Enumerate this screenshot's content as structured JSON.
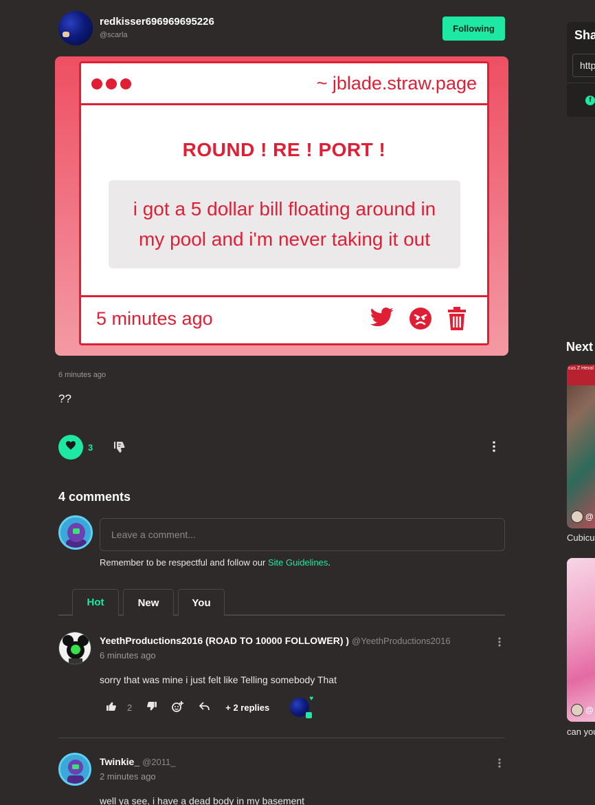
{
  "header": {
    "username": "redkisser696969695226",
    "handle": "@scarla",
    "follow_label": "Following"
  },
  "card": {
    "site": "~ jblade.straw.page",
    "title": "ROUND ! RE ! PORT !",
    "message": "i got a 5 dollar bill floating around in my pool and i'm never taking it out",
    "time": "5 minutes ago",
    "icons": [
      "twitter-icon",
      "angry-face-icon",
      "trash-icon"
    ],
    "accent_color": "#e01f35"
  },
  "post": {
    "time": "6 minutes ago",
    "body": "??",
    "like_count": "3"
  },
  "comments": {
    "title": "4 comments",
    "input_placeholder": "Leave a comment...",
    "guidelines_prefix": "Remember to be respectful and follow our ",
    "guidelines_link": "Site Guidelines",
    "guidelines_suffix": ".",
    "tabs": [
      {
        "label": "Hot",
        "active": true
      },
      {
        "label": "New",
        "active": false
      },
      {
        "label": "You",
        "active": false
      }
    ],
    "items": [
      {
        "name": "YeethProductions2016 (ROAD TO 10000 FOLLOWER) )",
        "handle": "@YeethProductions2016",
        "time": "6 minutes ago",
        "text": "sorry that was mine i just felt like Telling somebody That",
        "likes": "2",
        "replies": "+ 2 replies"
      },
      {
        "name": "Twinkie_",
        "handle": "@2011_",
        "time": "2 minutes ago",
        "text": "well ya see, i have a dead body in my basement"
      }
    ]
  },
  "sidebar": {
    "share_title": "Sha",
    "share_url": "http",
    "next_title": "Next",
    "thumbs": [
      {
        "band_text": "cus Z Hexal",
        "at": "@",
        "caption": "Cubicu"
      },
      {
        "at": "@",
        "caption": "can you"
      }
    ]
  },
  "colors": {
    "background": "#2d2a29",
    "accent": "#1de9a5",
    "card_red": "#e01f35"
  }
}
